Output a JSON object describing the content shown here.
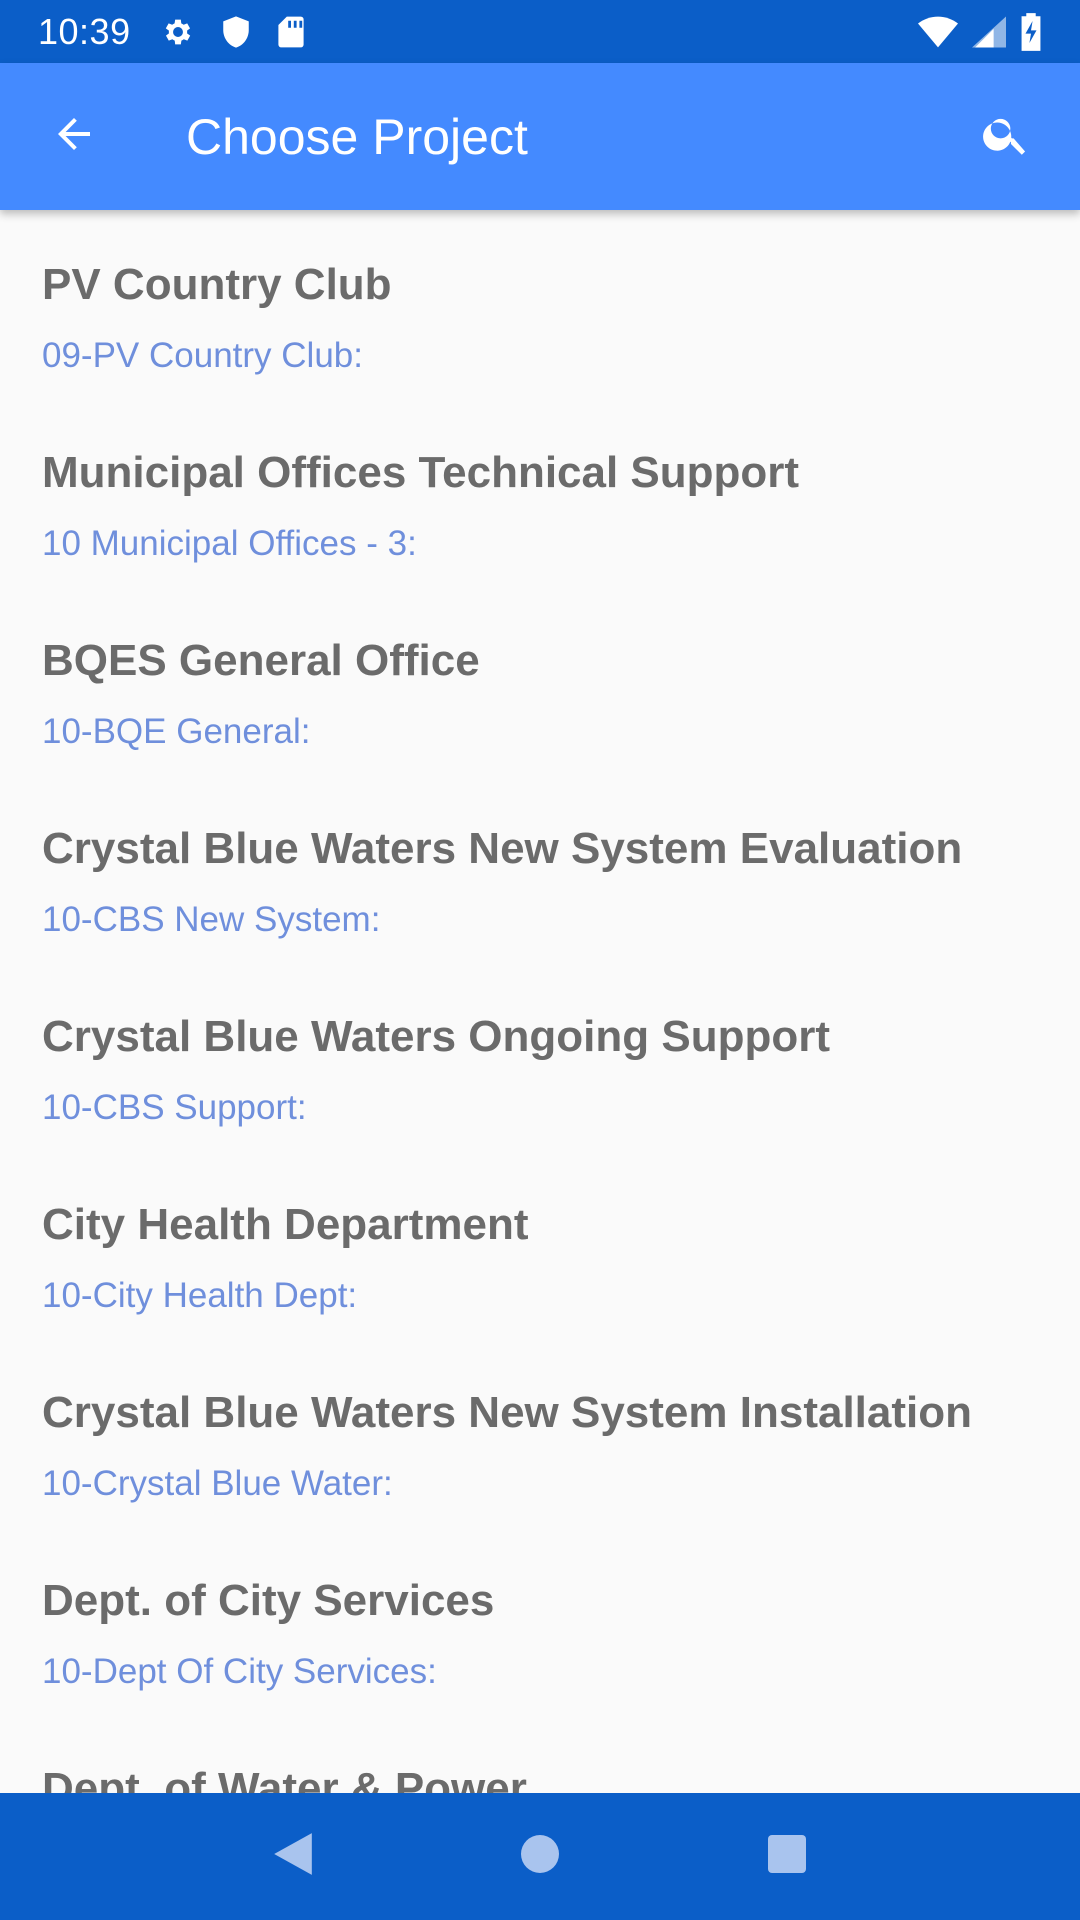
{
  "status_bar": {
    "time": "10:39",
    "icons": [
      "gear-icon",
      "shield-icon",
      "sd-card-icon",
      "wifi-icon",
      "signal-icon",
      "battery-charging-icon"
    ]
  },
  "app_bar": {
    "title": "Choose Project",
    "back_icon": "arrow-back-icon",
    "search_icon": "search-icon"
  },
  "projects": [
    {
      "name": "PV Country Club",
      "code": "09-PV Country Club:"
    },
    {
      "name": "Municipal Offices Technical Support",
      "code": "10 Municipal Offices - 3:"
    },
    {
      "name": "BQES General Office",
      "code": "10-BQE General:"
    },
    {
      "name": "Crystal Blue Waters New System Evaluation",
      "code": "10-CBS New System:"
    },
    {
      "name": "Crystal Blue Waters Ongoing Support",
      "code": "10-CBS Support:"
    },
    {
      "name": "City Health Department",
      "code": "10-City Health Dept:"
    },
    {
      "name": "Crystal Blue Waters New System Installation",
      "code": "10-Crystal Blue Water:"
    },
    {
      "name": "Dept. of City Services",
      "code": "10-Dept Of City Services:"
    },
    {
      "name": "Dept. of Water & Power",
      "code": ""
    }
  ],
  "nav_bar": {
    "icons": [
      "back-triangle-icon",
      "home-circle-icon",
      "recents-square-icon"
    ]
  },
  "colors": {
    "status_bar": "#0b5ec8",
    "app_bar": "#448aff",
    "title_text": "#6b6b6b",
    "code_text": "#6f8fdc"
  }
}
